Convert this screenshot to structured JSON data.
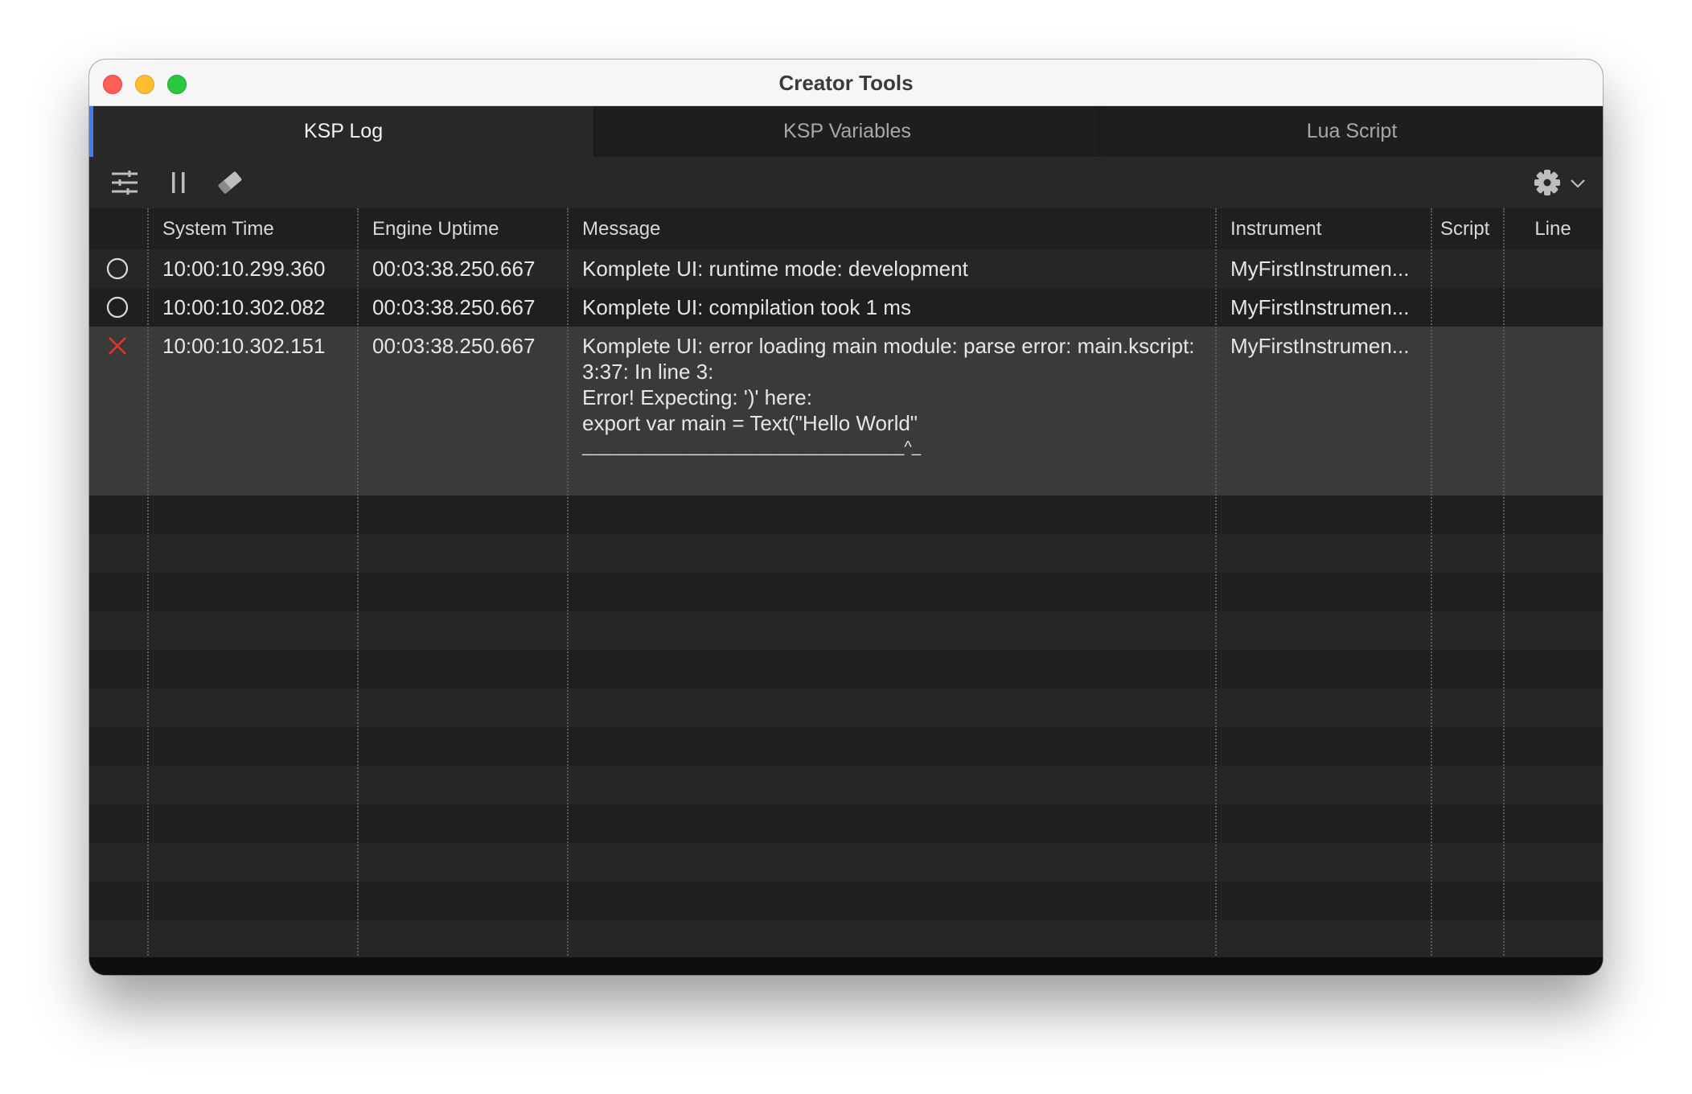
{
  "window": {
    "title": "Creator Tools"
  },
  "tabs": [
    "KSP Log",
    "KSP Variables",
    "Lua Script"
  ],
  "toolbar": {
    "icons": [
      "sliders-icon",
      "pause-icon",
      "eraser-icon",
      "gear-icon",
      "chevron-down-icon"
    ]
  },
  "table": {
    "columns": [
      "",
      "System Time",
      "Engine Uptime",
      "Message",
      "Instrument",
      "Script",
      "Line"
    ],
    "rows": [
      {
        "status": "info-circle-icon",
        "system_time": "10:00:10.299.360",
        "engine_uptime": "00:03:38.250.667",
        "message": [
          "Komplete UI: runtime mode: development"
        ],
        "instrument": "MyFirstInstrumen...",
        "script": "",
        "line": ""
      },
      {
        "status": "info-circle-icon",
        "system_time": "10:00:10.302.082",
        "engine_uptime": "00:03:38.250.667",
        "message": [
          "Komplete UI: compilation took 1 ms"
        ],
        "instrument": "MyFirstInstrumen...",
        "script": "",
        "line": ""
      },
      {
        "status": "error-x-icon",
        "system_time": "10:00:10.302.151",
        "engine_uptime": "00:03:38.250.667",
        "message": [
          "Komplete UI: error loading main module: parse error: main.kscript:",
          "3:37: In line 3:",
          "Error! Expecting: ')' here:",
          "export var main = Text(\"Hello World\"",
          "____________________________________^_"
        ],
        "instrument": "MyFirstInstrumen...",
        "script": "",
        "line": ""
      }
    ]
  },
  "colors": {
    "accent": "#3d7ff0",
    "error": "#e0352b",
    "background": "#1f1f1f",
    "selected_row": "#3a3a3a"
  }
}
